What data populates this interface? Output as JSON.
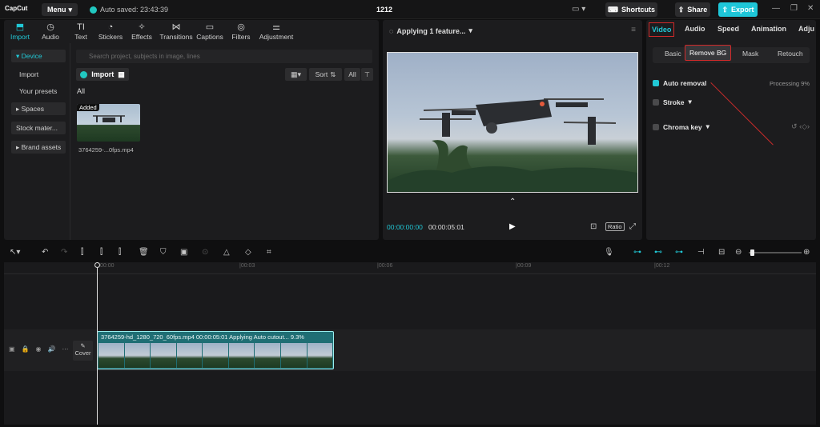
{
  "topbar": {
    "logo": "CapCut",
    "menu_label": "Menu",
    "autosave_text": "Auto saved: 23:43:39",
    "project_title": "1212",
    "shortcuts_label": "Shortcuts",
    "share_label": "Share",
    "export_label": "Export"
  },
  "tool_tabs": [
    {
      "label": "Import",
      "icon": "import-icon",
      "active": true
    },
    {
      "label": "Audio",
      "icon": "audio-icon"
    },
    {
      "label": "Text",
      "icon": "text-icon"
    },
    {
      "label": "Stickers",
      "icon": "stickers-icon"
    },
    {
      "label": "Effects",
      "icon": "effects-icon"
    },
    {
      "label": "Transitions",
      "icon": "transitions-icon"
    },
    {
      "label": "Captions",
      "icon": "captions-icon"
    },
    {
      "label": "Filters",
      "icon": "filters-icon"
    },
    {
      "label": "Adjustment",
      "icon": "adjustment-icon"
    }
  ],
  "side_nav": {
    "device": "Device",
    "import": "Import",
    "your_presets": "Your presets",
    "spaces": "Spaces",
    "stock": "Stock mater...",
    "brand_assets": "Brand assets"
  },
  "media": {
    "search_placeholder": "Search project, subjects in image, lines",
    "import_label": "Import",
    "sort_label": "Sort",
    "all_btn": "All",
    "all_label": "All",
    "added_badge": "Added",
    "thumb_name": "3764259-...0fps.mp4"
  },
  "preview": {
    "status": "Applying 1 feature...",
    "time_current": "00:00:00:00",
    "time_total": "00:00:05:01",
    "ratio_label": "Ratio"
  },
  "right_panel": {
    "tabs": [
      "Video",
      "Audio",
      "Speed",
      "Animation",
      "Adju"
    ],
    "subtabs": [
      "Basic",
      "Remove BG",
      "Mask",
      "Retouch"
    ],
    "auto_removal": "Auto removal",
    "processing": "Processing 9%",
    "stroke": "Stroke",
    "chroma_key": "Chroma key"
  },
  "timeline": {
    "ruler": [
      "00:00",
      "|00:03",
      "|00:06",
      "|00:09",
      "|00:12"
    ],
    "cover_label": "Cover",
    "clip_label": "3764259-hd_1280_720_60fps.mp4   00:00:05:01   Applying Auto cutout... 9.3%"
  },
  "colors": {
    "accent": "#21c8d6",
    "highlight_box": "#d12a2a",
    "export": "#1ec6d8"
  }
}
